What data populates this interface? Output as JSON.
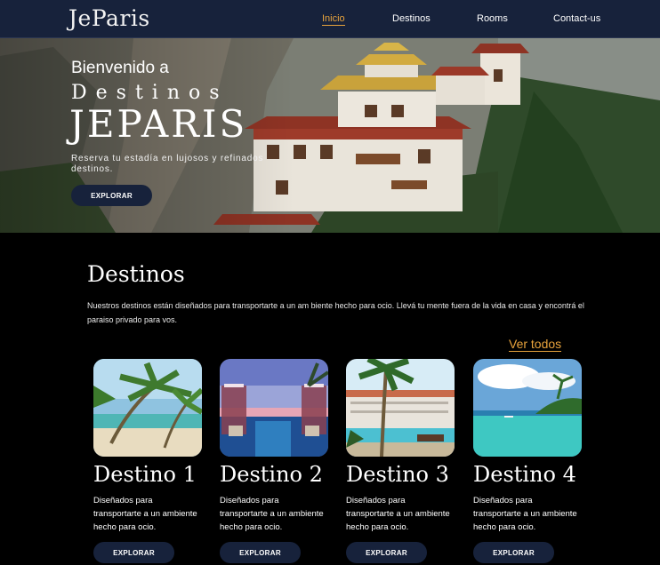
{
  "nav": {
    "logo": "JeParis",
    "items": [
      {
        "label": "Inicio",
        "active": true
      },
      {
        "label": "Destinos",
        "active": false
      },
      {
        "label": "Rooms",
        "active": false
      },
      {
        "label": "Contact-us",
        "active": false
      }
    ]
  },
  "hero": {
    "welcome": "Bienvenido a",
    "destinos": "Destinos",
    "brand": "JEPARIS",
    "subtitle": "Reserva tu estadía en lujosos y refinados destinos.",
    "button": "EXPLORAR"
  },
  "section": {
    "title": "Destinos",
    "description": "Nuestros destinos están diseñados para transportarte a un am biente hecho para ocio. Llevá tu mente fuera de la vida en casa  y encontrá el paraiso privado para vos.",
    "see_all": "Ver todos"
  },
  "cards": [
    {
      "title": "Destino 1",
      "text": "Diseñados para transportarte a un ambiente hecho para ocio.",
      "button": "EXPLORAR"
    },
    {
      "title": "Destino 2",
      "text": "Diseñados para transportarte a un ambiente hecho para ocio.",
      "button": "EXPLORAR"
    },
    {
      "title": "Destino 3",
      "text": "Diseñados para transportarte a un ambiente hecho para ocio.",
      "button": "EXPLORAR"
    },
    {
      "title": "Destino 4",
      "text": "Diseñados para transportarte a un ambiente hecho para ocio.",
      "button": "EXPLORAR"
    }
  ],
  "colors": {
    "nav_bg": "#17223b",
    "accent": "#e8a33c",
    "button_bg": "#17223b",
    "page_bg": "#000000"
  }
}
